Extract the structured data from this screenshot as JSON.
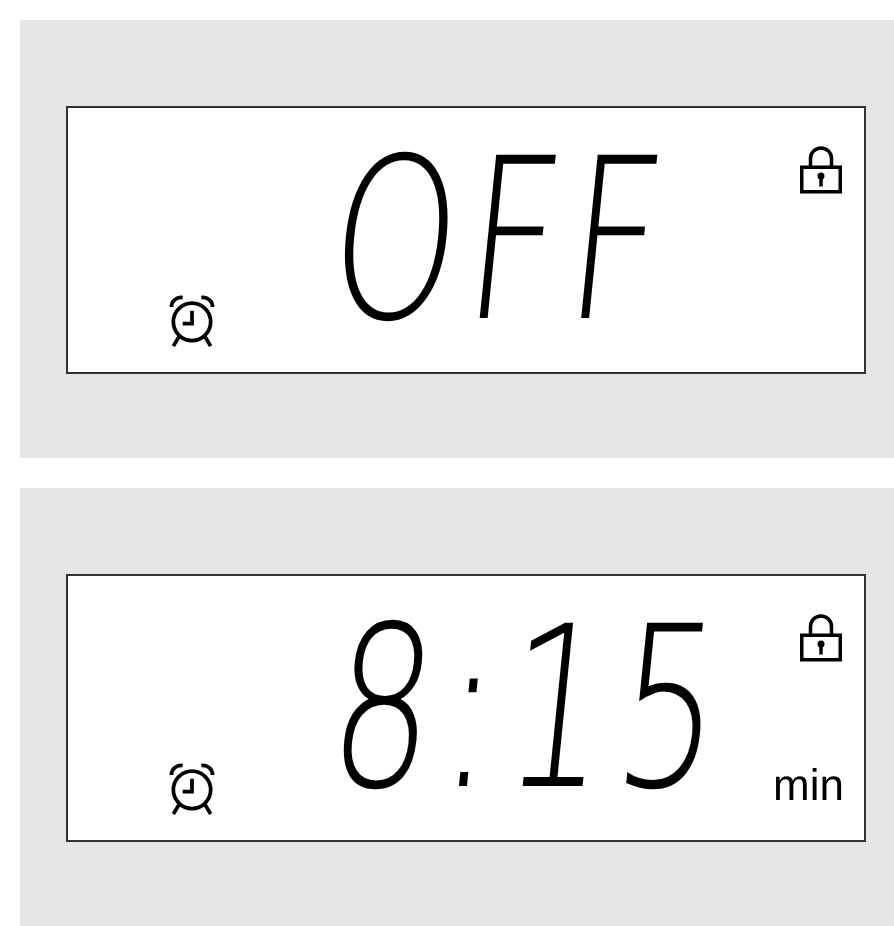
{
  "displays": [
    {
      "reading": "OFF"
    },
    {
      "reading": "8:15",
      "unit": "min"
    }
  ]
}
